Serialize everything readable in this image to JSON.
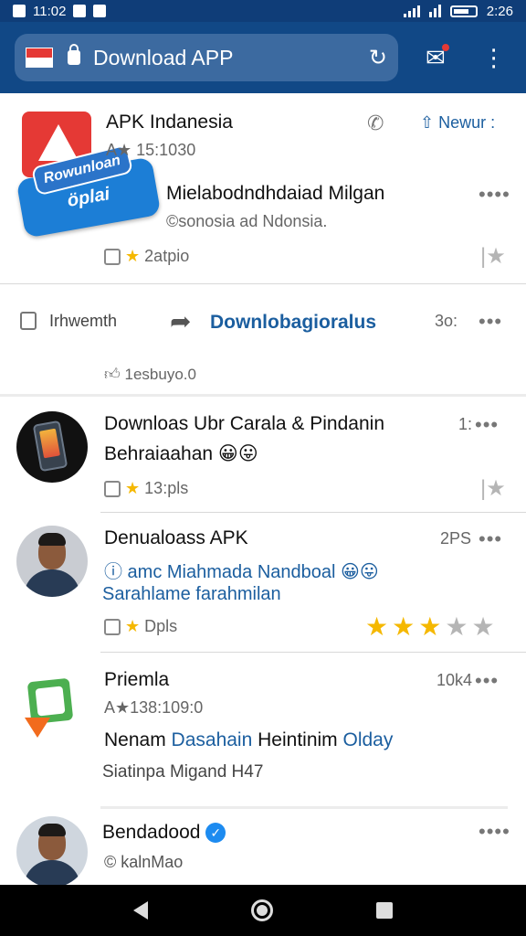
{
  "status_bar": {
    "time_left": "11:02",
    "time_right": "2:26"
  },
  "toolbar": {
    "url_text": "Download APP",
    "reload_icon": "reload-icon",
    "notif_icon": "notification-icon",
    "menu_icon": "more-vert-icon"
  },
  "card1": {
    "name": "APK Indanesia",
    "time": "A★ 15:1030",
    "action_label": "Newur :",
    "badge_small": "Rowunloan",
    "badge_big": "öplai",
    "headline": "Mielabodndhdaiad Milgan",
    "handle": "©sonosia ad Ndonsia.",
    "stats": "2atpio"
  },
  "row2": {
    "label": "Irhwemth",
    "link": "Downlobagioralus",
    "time": "3o:",
    "likes": "1esbuyo.0"
  },
  "posts": [
    {
      "title": "Downloas Ubr Carala & Pindanin",
      "subtitle": "Behraiaahan 😀😛",
      "time": "1:",
      "stats": "13:pls"
    },
    {
      "title": "Denualoass APK",
      "line2": "ⓘ amc Miahmada Nandboal 😀😛",
      "line3": "Sarahlame farahmilan",
      "time": "2PS",
      "stats": "Dpls",
      "rating": 3
    },
    {
      "title": "Priemla",
      "meta": "A★138:109:0",
      "time": "10k4",
      "line_a": "Nenam",
      "line_b": "Dasahain",
      "line_c": "Heintinim",
      "line_d": "Olday",
      "line4": "Siatinpa Migand H47"
    },
    {
      "title": "Bendadood",
      "handle": "© kalnMao"
    }
  ],
  "colors": {
    "header_bg": "#114886",
    "status_bg": "#0f3d78",
    "link_blue": "#1b5e9f",
    "star": "#f5b800"
  }
}
